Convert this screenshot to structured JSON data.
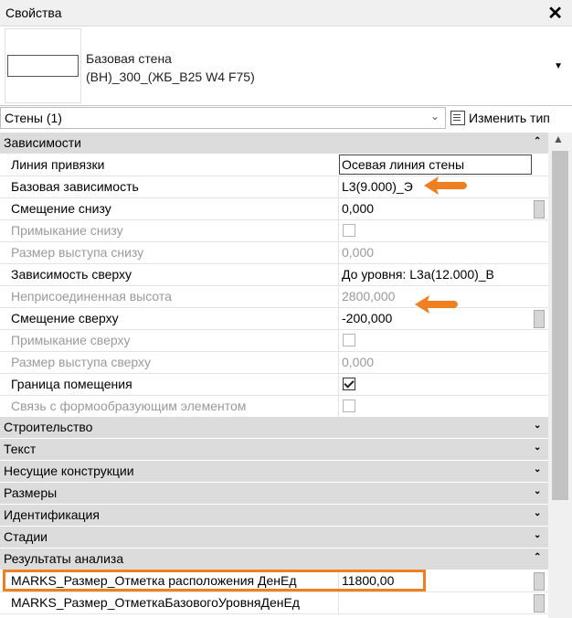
{
  "window": {
    "title": "Свойства"
  },
  "type_selector": {
    "name_line1": "Базовая стена",
    "name_line2": "(ВН)_300_(ЖБ_B25 W4 F75)"
  },
  "filter": {
    "value": "Стены (1)",
    "edit_type_label": "Изменить тип"
  },
  "groups": {
    "constraints": "Зависимости",
    "construction": "Строительство",
    "text": "Текст",
    "structural": "Несущие конструкции",
    "dimensions": "Размеры",
    "identity": "Идентификация",
    "phasing": "Стадии",
    "analysis": "Результаты анализа"
  },
  "props": {
    "location_line": {
      "name": "Линия привязки",
      "value": "Осевая линия стены"
    },
    "base_constraint": {
      "name": "Базовая зависимость",
      "value": "L3(9.000)_Э"
    },
    "base_offset": {
      "name": "Смещение снизу",
      "value": "0,000"
    },
    "base_attached": {
      "name": "Примыкание снизу"
    },
    "base_extension": {
      "name": "Размер выступа снизу",
      "value": "0,000"
    },
    "top_constraint": {
      "name": "Зависимость сверху",
      "value": "До уровня: L3a(12.000)_В"
    },
    "unconnected_height": {
      "name": "Неприсоединенная высота",
      "value": "2800,000"
    },
    "top_offset": {
      "name": "Смещение сверху",
      "value": "-200,000"
    },
    "top_attached": {
      "name": "Примыкание сверху"
    },
    "top_extension": {
      "name": "Размер выступа сверху",
      "value": "0,000"
    },
    "room_bounding": {
      "name": "Граница помещения",
      "checked": true
    },
    "related_mass": {
      "name": "Связь с формообразующим элементом",
      "checked": false
    },
    "marks_location": {
      "name": "MARKS_Размер_Отметка расположения ДенЕд",
      "value": "11800,00"
    },
    "marks_base_level": {
      "name": "MARKS_Размер_ОтметкаБазовогоУровняДенЕд",
      "value": ""
    }
  },
  "colors": {
    "annotation": "#f07f1f",
    "group_bg": "#dcdcdc"
  },
  "icons": [
    "close-icon",
    "dropdown-arrow-icon",
    "edit-type-icon",
    "expand-chevron-icon",
    "collapse-chevron-icon"
  ]
}
